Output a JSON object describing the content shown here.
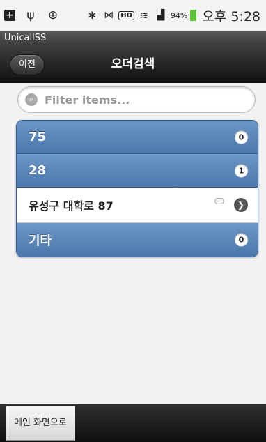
{
  "status_bar": {
    "icons_left": [
      "plus-box-icon",
      "usb-icon",
      "gps-icon"
    ],
    "icons_right": [
      "bluetooth-icon",
      "mute-icon",
      "hd-icon",
      "wifi-icon",
      "signal-icon"
    ],
    "hd_label": "HD",
    "battery": "94%",
    "time": "오후 5:28"
  },
  "app": {
    "name": "UnicallSS"
  },
  "header": {
    "back_label": "이전",
    "title": "오더검색"
  },
  "filter": {
    "placeholder": "Filter items...",
    "value": ""
  },
  "list": {
    "rows": [
      {
        "type": "divider",
        "label": "75",
        "count": "0"
      },
      {
        "type": "divider",
        "label": "28",
        "count": "1"
      },
      {
        "type": "item",
        "label": "유성구 대학로 87",
        "count": ""
      },
      {
        "type": "divider",
        "label": "기타",
        "count": "0"
      }
    ]
  },
  "footer": {
    "main_button": "메인 화면으로"
  },
  "colors": {
    "divider": "#5a86b8",
    "header": "#1e1e1e"
  }
}
